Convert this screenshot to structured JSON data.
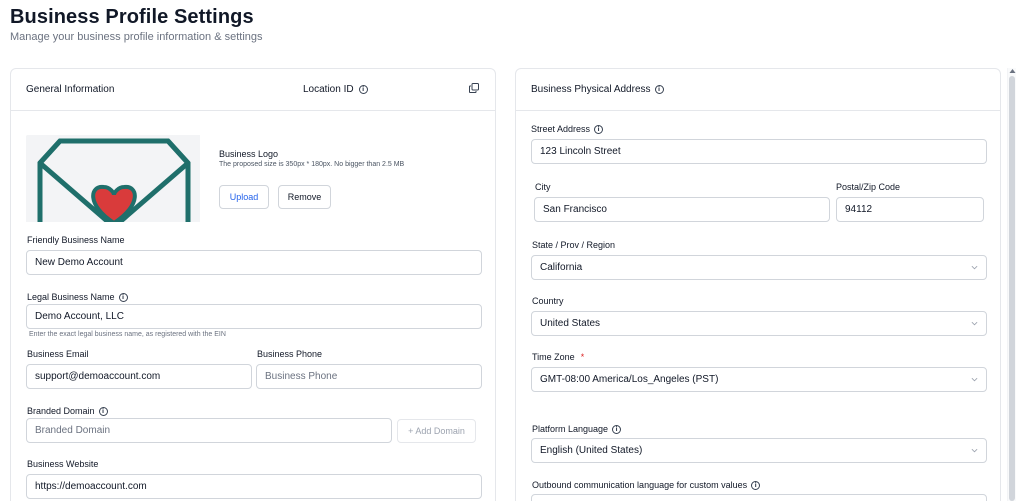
{
  "page": {
    "title": "Business Profile Settings",
    "subtitle": "Manage your business profile information & settings"
  },
  "general": {
    "title": "General Information",
    "location_id_label": "Location ID",
    "logo": {
      "label": "Business Logo",
      "hint": "The proposed size is 350px * 180px. No bigger than 2.5 MB",
      "upload_label": "Upload",
      "remove_label": "Remove"
    },
    "friendly_name": {
      "label": "Friendly Business Name",
      "value": "New Demo Account"
    },
    "legal_name": {
      "label": "Legal Business Name",
      "value": "Demo Account, LLC",
      "helper": "Enter the exact legal business name, as registered with the EIN"
    },
    "email": {
      "label": "Business Email",
      "value": "support@demoaccount.com"
    },
    "phone": {
      "label": "Business Phone",
      "placeholder": "Business Phone"
    },
    "domain": {
      "label": "Branded Domain",
      "placeholder": "Branded Domain",
      "add_label": "+ Add Domain"
    },
    "website": {
      "label": "Business Website",
      "value": "https://demoaccount.com"
    }
  },
  "address": {
    "title": "Business Physical Address",
    "street": {
      "label": "Street Address",
      "value": "123 Lincoln Street"
    },
    "city": {
      "label": "City",
      "value": "San Francisco"
    },
    "zip": {
      "label": "Postal/Zip Code",
      "value": "94112"
    },
    "state": {
      "label": "State / Prov / Region",
      "value": "California"
    },
    "country": {
      "label": "Country",
      "value": "United States"
    },
    "timezone": {
      "label": "Time Zone",
      "required_mark": "*",
      "value": "GMT-08:00 America/Los_Angeles (PST)"
    },
    "platform_language": {
      "label": "Platform Language",
      "value": "English (United States)"
    },
    "outbound_language": {
      "label": "Outbound communication language for custom values"
    }
  },
  "colors": {
    "accent": "#2563eb",
    "logo_teal": "#1f6f6b",
    "logo_heart": "#d93b3b",
    "required": "#dc2626"
  }
}
